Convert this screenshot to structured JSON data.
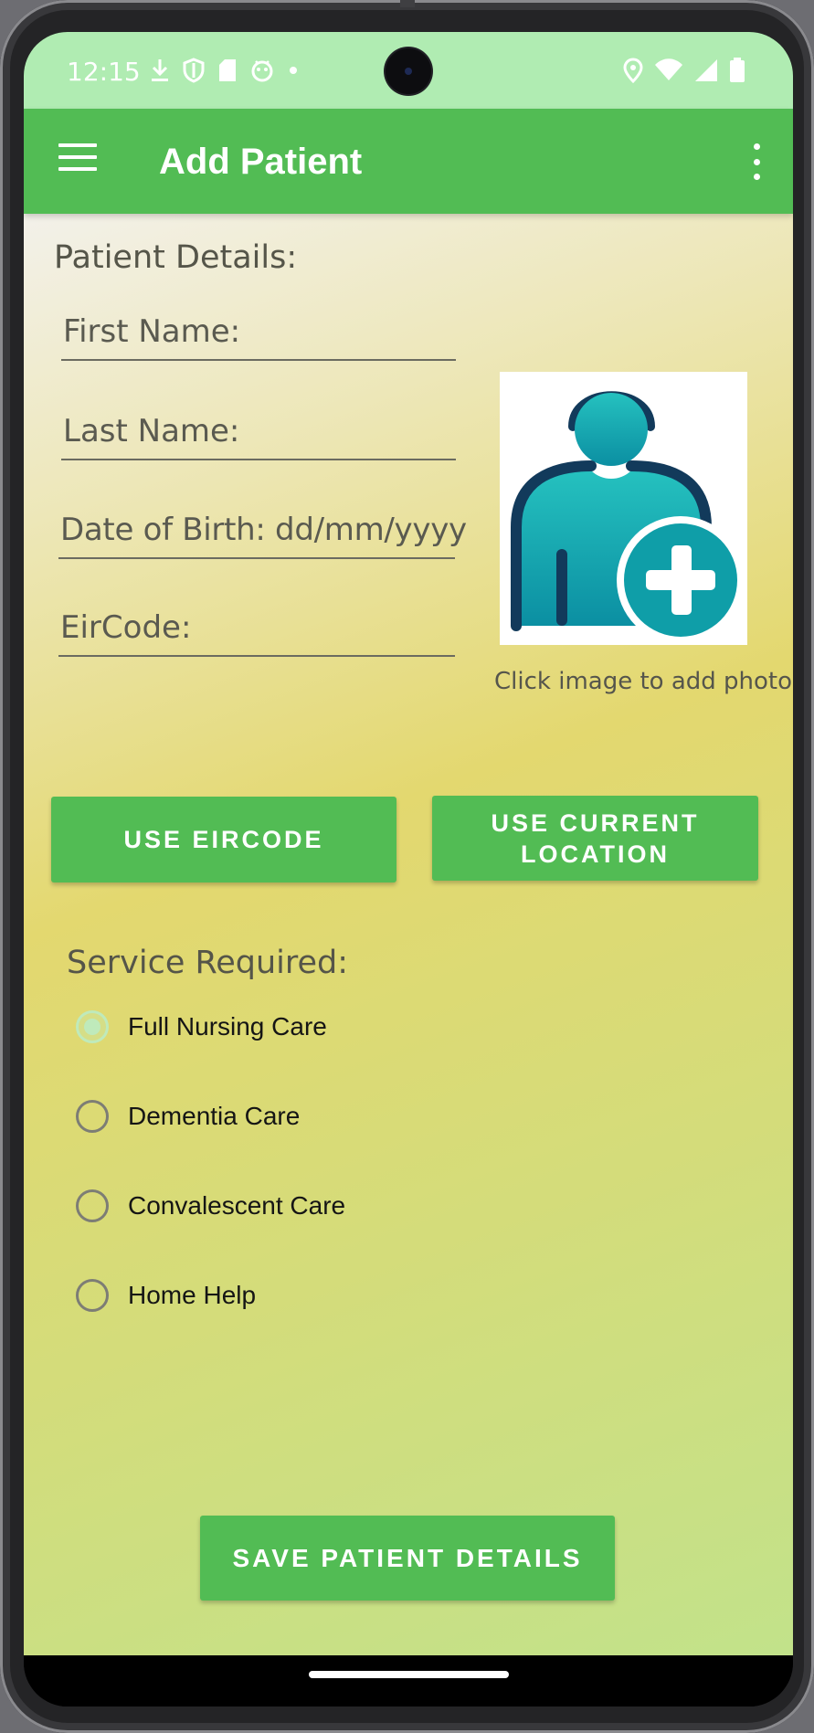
{
  "status_bar": {
    "time": "12:15",
    "left_icons": [
      "download-icon",
      "shield-icon",
      "sd-card-icon",
      "android-debug-icon",
      "dot-icon"
    ],
    "right_icons": [
      "location-icon",
      "wifi-icon",
      "cell-signal-icon",
      "battery-icon"
    ]
  },
  "app_bar": {
    "title": "Add Patient",
    "menu_icon": "hamburger-menu-icon",
    "overflow_icon": "more-vert-icon",
    "color": "#52bc54"
  },
  "form": {
    "section_title": "Patient Details:",
    "first_name_placeholder": "First Name:",
    "last_name_placeholder": "Last Name:",
    "dob_placeholder": "Date of Birth: dd/mm/yyyy",
    "eircode_placeholder": "EirCode:",
    "photo_caption": "Click image to add photo",
    "photo_icon": "add-patient-photo-icon"
  },
  "buttons": {
    "use_eircode": "USE EIRCODE",
    "use_location_line1": "USE CURRENT",
    "use_location_line2": "LOCATION",
    "save": "SAVE PATIENT DETAILS"
  },
  "service": {
    "title": "Service Required:",
    "options": [
      {
        "label": "Full Nursing Care",
        "checked": true
      },
      {
        "label": "Dementia Care",
        "checked": false
      },
      {
        "label": "Convalescent Care",
        "checked": false
      },
      {
        "label": "Home Help",
        "checked": false
      }
    ]
  },
  "colors": {
    "accent": "#52bc54",
    "status_bar": "#b0ecb2",
    "photo_teal": "#17b5b6",
    "photo_navy": "#123a5b"
  }
}
